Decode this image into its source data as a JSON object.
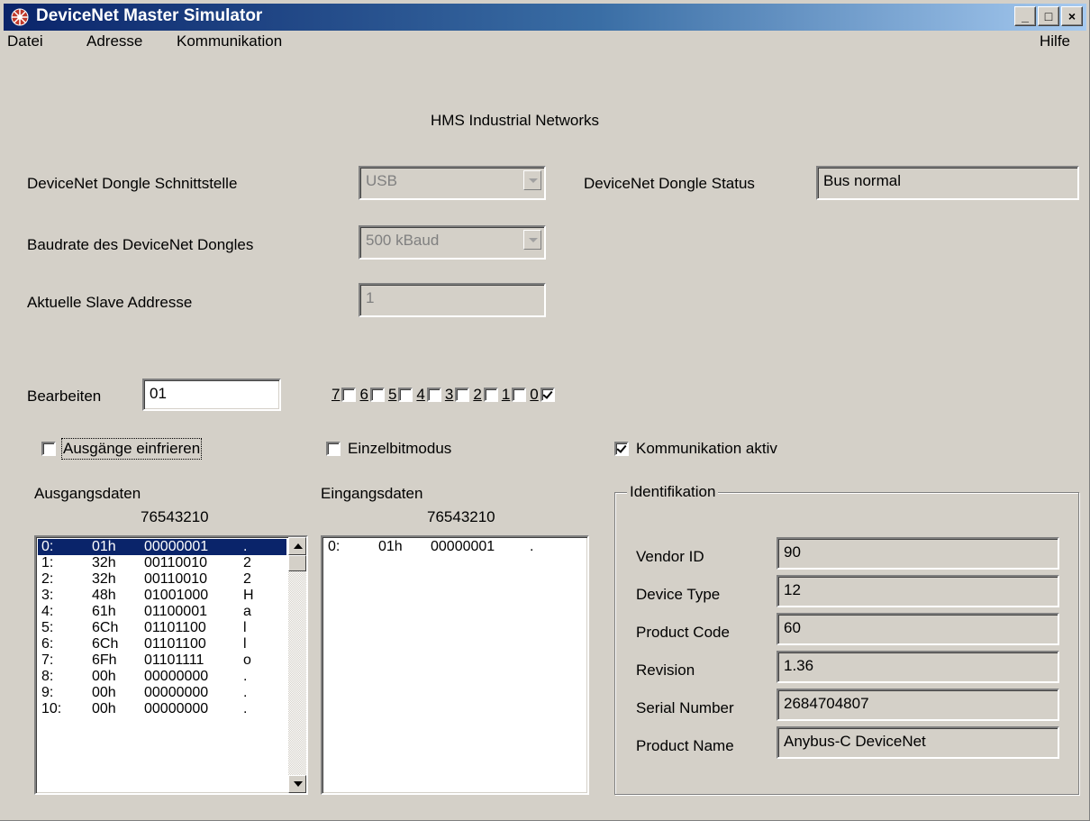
{
  "window": {
    "title": "DeviceNet Master Simulator",
    "minimize": "_",
    "maximize": "□",
    "close": "×"
  },
  "menu": {
    "file": "Datei",
    "address": "Adresse",
    "communication": "Kommunikation",
    "help": "Hilfe"
  },
  "header": {
    "company": "HMS Industrial Networks"
  },
  "settings": {
    "interface_label": "DeviceNet Dongle Schnittstelle",
    "interface_value": "USB",
    "status_label": "DeviceNet Dongle Status",
    "status_value": "Bus normal",
    "baud_label": "Baudrate des DeviceNet Dongles",
    "baud_value": "500 kBaud",
    "slave_label": "Aktuelle Slave Addresse",
    "slave_value": "1"
  },
  "edit": {
    "label": "Bearbeiten",
    "value": "01",
    "bits": [
      {
        "label": "7",
        "checked": false
      },
      {
        "label": "6",
        "checked": false
      },
      {
        "label": "5",
        "checked": false
      },
      {
        "label": "4",
        "checked": false
      },
      {
        "label": "3",
        "checked": false
      },
      {
        "label": "2",
        "checked": false
      },
      {
        "label": "1",
        "checked": false
      },
      {
        "label": "0",
        "checked": true
      }
    ]
  },
  "options": {
    "freeze_outputs": "Ausgänge einfrieren",
    "freeze_checked": false,
    "single_bit_mode": "Einzelbitmodus",
    "single_bit_checked": false,
    "comm_active": "Kommunikation aktiv",
    "comm_checked": true
  },
  "output_data": {
    "label": "Ausgangsdaten",
    "bit_header": "76543210",
    "rows": [
      [
        "0:",
        "01h",
        "00000001",
        "."
      ],
      [
        "1:",
        "32h",
        "00110010",
        "2"
      ],
      [
        "2:",
        "32h",
        "00110010",
        "2"
      ],
      [
        "3:",
        "48h",
        "01001000",
        "H"
      ],
      [
        "4:",
        "61h",
        "01100001",
        "a"
      ],
      [
        "5:",
        "6Ch",
        "01101100",
        "l"
      ],
      [
        "6:",
        "6Ch",
        "01101100",
        "l"
      ],
      [
        "7:",
        "6Fh",
        "01101111",
        "o"
      ],
      [
        "8:",
        "00h",
        "00000000",
        "."
      ],
      [
        "9:",
        "00h",
        "00000000",
        "."
      ],
      [
        "10:",
        "00h",
        "00000000",
        "."
      ]
    ]
  },
  "input_data": {
    "label": "Eingangsdaten",
    "bit_header": "76543210",
    "rows": [
      [
        "0:",
        "01h",
        "00000001",
        "."
      ]
    ]
  },
  "identification": {
    "title": "Identifikation",
    "fields": [
      {
        "label": "Vendor ID",
        "value": "90"
      },
      {
        "label": "Device Type",
        "value": "12"
      },
      {
        "label": "Product Code",
        "value": "60"
      },
      {
        "label": "Revision",
        "value": "1.36"
      },
      {
        "label": "Serial Number",
        "value": "2684704807"
      },
      {
        "label": "Product Name",
        "value": "Anybus-C DeviceNet"
      }
    ]
  }
}
